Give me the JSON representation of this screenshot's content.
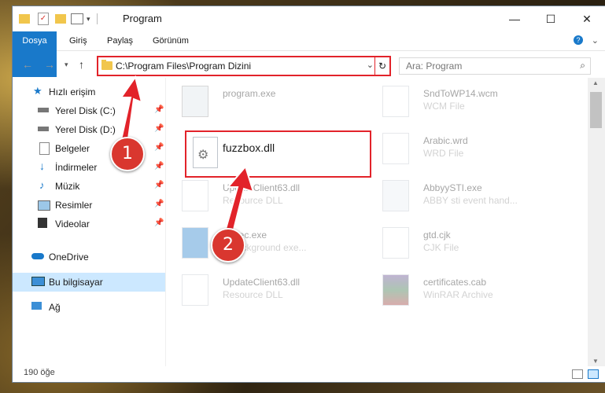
{
  "window": {
    "title": "Program"
  },
  "ribbon": {
    "tabs": [
      "Dosya",
      "Giriş",
      "Paylaş",
      "Görünüm"
    ]
  },
  "address": {
    "path": "C:\\Program Files\\Program Dizini"
  },
  "search": {
    "placeholder": "Ara: Program"
  },
  "sidebar": {
    "quick_access": "Hızlı erişim",
    "items": [
      {
        "label": "Yerel Disk (C:)"
      },
      {
        "label": "Yerel Disk (D:)"
      },
      {
        "label": "Belgeler"
      },
      {
        "label": "İndirmeler"
      },
      {
        "label": "Müzik"
      },
      {
        "label": "Resimler"
      },
      {
        "label": "Videolar"
      }
    ],
    "onedrive": "OneDrive",
    "thispc": "Bu bilgisayar",
    "network": "Ağ"
  },
  "files": [
    {
      "name": "program.exe",
      "type": ""
    },
    {
      "name": "SndToWP14.wcm",
      "type": "WCM File"
    },
    {
      "name": "fuzzbox.dll",
      "type": ""
    },
    {
      "name": "Arabic.wrd",
      "type": "WRD File"
    },
    {
      "name": "UpdateClient63.dll",
      "type": "Resource DLL"
    },
    {
      "name": "AbbyySTI.exe",
      "type": "ABBY sti event hand..."
    },
    {
      "name": "eExec.exe",
      "type": "Y background exe..."
    },
    {
      "name": "gtd.cjk",
      "type": "CJK File"
    },
    {
      "name": "UpdateClient63.dll",
      "type": "Resource DLL"
    },
    {
      "name": "certificates.cab",
      "type": "WinRAR Archive"
    }
  ],
  "status": {
    "count": "190 öğe"
  },
  "annotations": {
    "step1": "1",
    "step2": "2"
  },
  "colors": {
    "accent": "#1979ca",
    "highlight": "#e2232a"
  }
}
